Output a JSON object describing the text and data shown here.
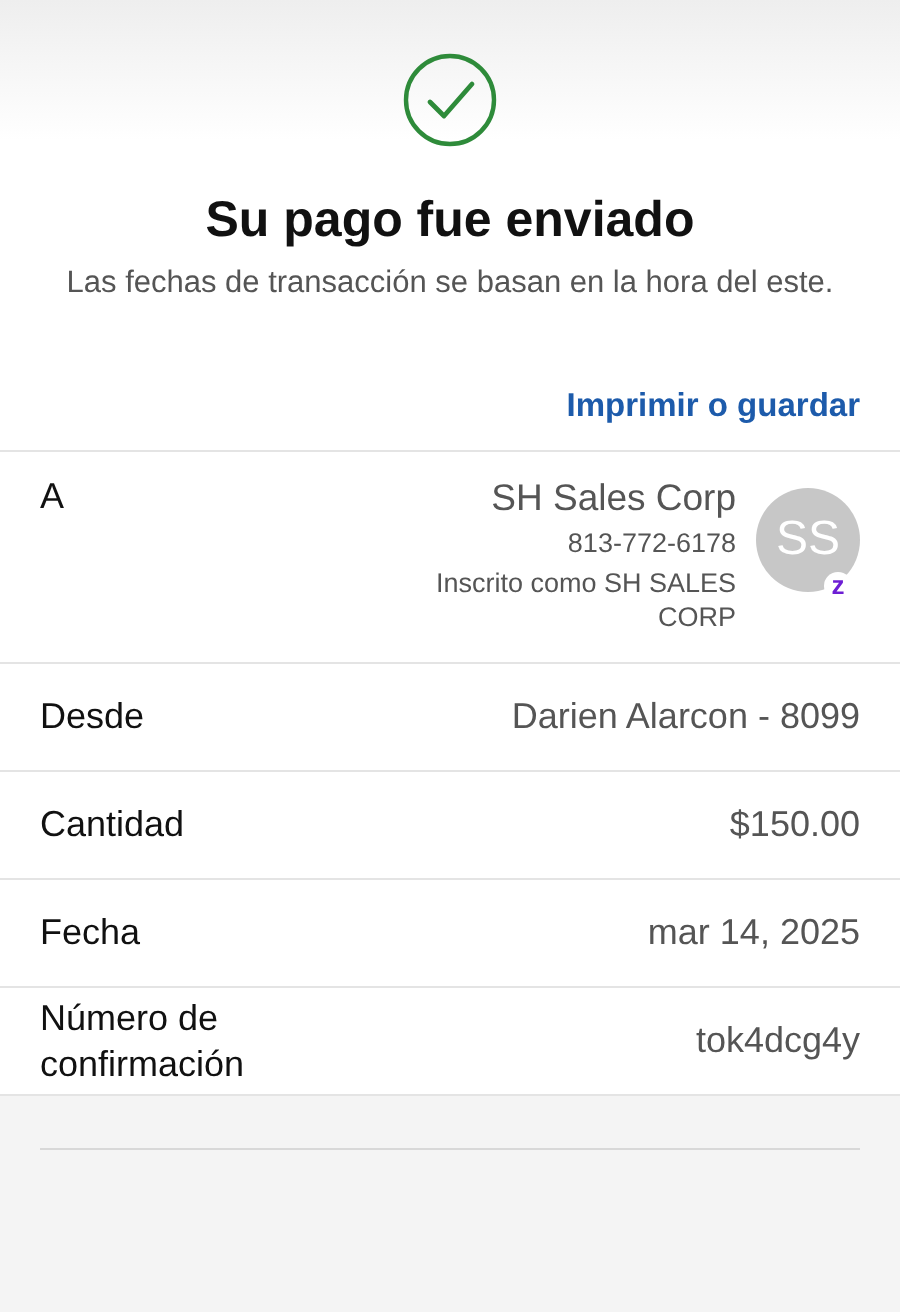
{
  "header": {
    "title": "Su pago fue enviado",
    "subtitle": "Las fechas de transacción se basan en la hora del este."
  },
  "print_link": "Imprimir o guardar",
  "recipient": {
    "label": "A",
    "name": "SH Sales Corp",
    "phone": "813-772-6178",
    "enrolled": "Inscrito como SH SALES CORP",
    "initials": "SS",
    "badge": "z"
  },
  "details": [
    {
      "label": "Desde",
      "value": "Darien Alarcon - 8099"
    },
    {
      "label": "Cantidad",
      "value": "$150.00"
    },
    {
      "label": "Fecha",
      "value": "mar 14, 2025"
    },
    {
      "label": "Número de confirmación",
      "value": "tok4dcg4y"
    }
  ]
}
